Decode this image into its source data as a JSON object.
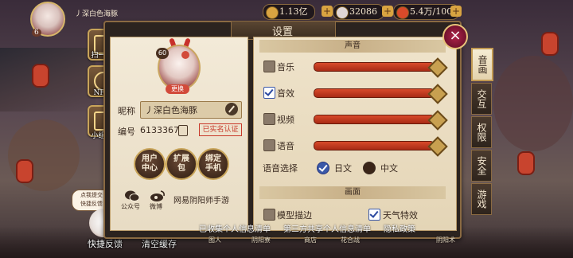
{
  "topbar": {
    "player_name": "丿深白色海豚",
    "level": "6",
    "stamina": "1.13亿",
    "jade": "32086",
    "coins": "5.4万/100",
    "plus": "+"
  },
  "side_buttons": [
    {
      "label": "扫一扫"
    },
    {
      "label": "NFC"
    },
    {
      "label": "小组件"
    }
  ],
  "feedback_bubble": {
    "line1": "点我提交",
    "line2": "快捷反馈"
  },
  "bottom_left": {
    "feedback": "快捷反馈",
    "clear_cache": "清空缓存"
  },
  "panel": {
    "title": "设置"
  },
  "profile": {
    "level": "60",
    "change_avatar": "更换",
    "nickname_label": "昵称",
    "nickname": "丿深白色海豚",
    "id_label": "编号",
    "id_value": "6133367",
    "verified": "已实名认证",
    "buttons": [
      {
        "line1": "用户",
        "line2": "中心"
      },
      {
        "line1": "扩展",
        "line2": "包"
      },
      {
        "line1": "绑定",
        "line2": "手机"
      }
    ],
    "social": [
      {
        "label": "公众号"
      },
      {
        "label": "微博"
      }
    ],
    "netease": "网易阴阳师手游"
  },
  "settings": {
    "sound_header": "声音",
    "rows": [
      {
        "label": "音乐",
        "checked": false,
        "level": 1.0
      },
      {
        "label": "音效",
        "checked": true,
        "level": 1.0
      },
      {
        "label": "视频",
        "checked": false,
        "level": 1.0
      },
      {
        "label": "语音",
        "checked": false,
        "level": 1.0
      }
    ],
    "voice_label": "语音选择",
    "voice_options": [
      {
        "label": "日文",
        "selected": true
      },
      {
        "label": "中文",
        "selected": false
      }
    ],
    "picture_header": "画面",
    "picture_options": [
      {
        "label": "模型描边",
        "checked": false
      },
      {
        "label": "天气特效",
        "checked": true
      }
    ]
  },
  "close_label": "×",
  "tabs": [
    {
      "label": "音画",
      "active": true
    },
    {
      "label": "交互",
      "active": false
    },
    {
      "label": "权限",
      "active": false
    },
    {
      "label": "安全",
      "active": false
    },
    {
      "label": "游戏",
      "active": false
    }
  ],
  "bottom_links": {
    "personal_info": "已收集个人信息清单",
    "third_party": "第三方共享个人信息清单",
    "privacy": "隐私政策"
  },
  "bottom_nav": [
    "图人",
    "阴阳寮",
    "商店",
    "花合战",
    "阴阳术"
  ],
  "colors": {
    "panel_bg": "#2b231f",
    "sheet_bg": "#f3ead8",
    "accent_red": "#d84a2a",
    "check_blue": "#3a58a8",
    "gold_border": "#c9a55a"
  }
}
